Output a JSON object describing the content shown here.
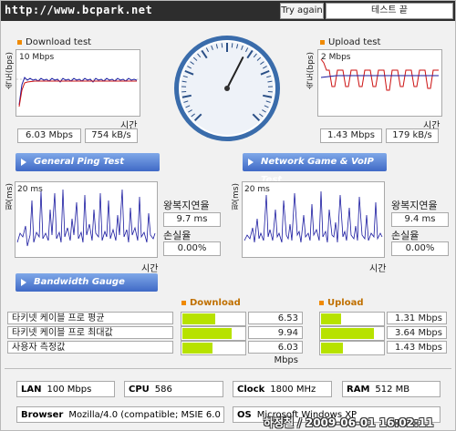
{
  "header": {
    "site_url": "http://www.bcpark.net",
    "try_again_label": "Try again",
    "status_label": "테스트 끝"
  },
  "download": {
    "title": "Download test",
    "y_axis_label": "속도(bps)",
    "scale_label": "10 Mbps",
    "x_axis_label": "시간",
    "speed_mbps": "6.03 Mbps",
    "speed_kbs": "754 kB/s"
  },
  "upload": {
    "title": "Upload test",
    "y_axis_label": "속도(bps)",
    "scale_label": "2 Mbps",
    "x_axis_label": "시간",
    "speed_mbps": "1.43 Mbps",
    "speed_kbs": "179 kB/s"
  },
  "gauge": {
    "needle_fraction": 0.6
  },
  "ping": {
    "title": "General Ping Test",
    "y_axis_label": "핑(ms)",
    "scale_label": "20 ms",
    "x_axis_label": "시간",
    "rtt_label": "왕복지연율",
    "rtt_value": "9.7 ms",
    "loss_label": "손실율",
    "loss_value": "0.00%"
  },
  "game": {
    "title": "Network Game & VoIP Test",
    "y_axis_label": "핑(ms)",
    "scale_label": "20 ms",
    "x_axis_label": "시간",
    "rtt_label": "왕복지연율",
    "rtt_value": "9.4 ms",
    "loss_label": "손실율",
    "loss_value": "0.00%"
  },
  "bandwidth": {
    "title": "Bandwidth Gauge",
    "download_header": "Download",
    "upload_header": "Upload",
    "rows": [
      {
        "label": "타키넷 케이블 프로 평균",
        "download": "6.53 Mbps",
        "download_fraction": 0.53,
        "upload": "1.31 Mbps",
        "upload_fraction": 0.32
      },
      {
        "label": "타키넷 케이블 프로 최대값",
        "download": "9.94 Mbps",
        "download_fraction": 0.8,
        "upload": "3.64 Mbps",
        "upload_fraction": 0.86
      },
      {
        "label": "사용자 측정값",
        "download": "6.03 Mbps",
        "download_fraction": 0.48,
        "upload": "1.43 Mbps",
        "upload_fraction": 0.35
      }
    ]
  },
  "system": {
    "lan_label": "LAN",
    "lan_value": "100 Mbps",
    "cpu_label": "CPU",
    "cpu_value": "586",
    "clock_label": "Clock",
    "clock_value": "1800 MHz",
    "ram_label": "RAM",
    "ram_value": "512 MB",
    "browser_label": "Browser",
    "browser_value": "Mozilla/4.0 (compatible; MSIE 6.0",
    "os_label": "OS",
    "os_value": "Microsoft Windows XP"
  },
  "watermark": "하정철 / 2009-06-01 16:02:11",
  "colors": {
    "header_bg": "#2d2d2d",
    "accent_orange": "#f08a00",
    "section_blue": "#3f69c6",
    "gauge_fill": "#b7e200",
    "download_line": "#1a1aa0",
    "upload_line": "#cc1111",
    "ping_line": "#1a1aa0"
  }
}
